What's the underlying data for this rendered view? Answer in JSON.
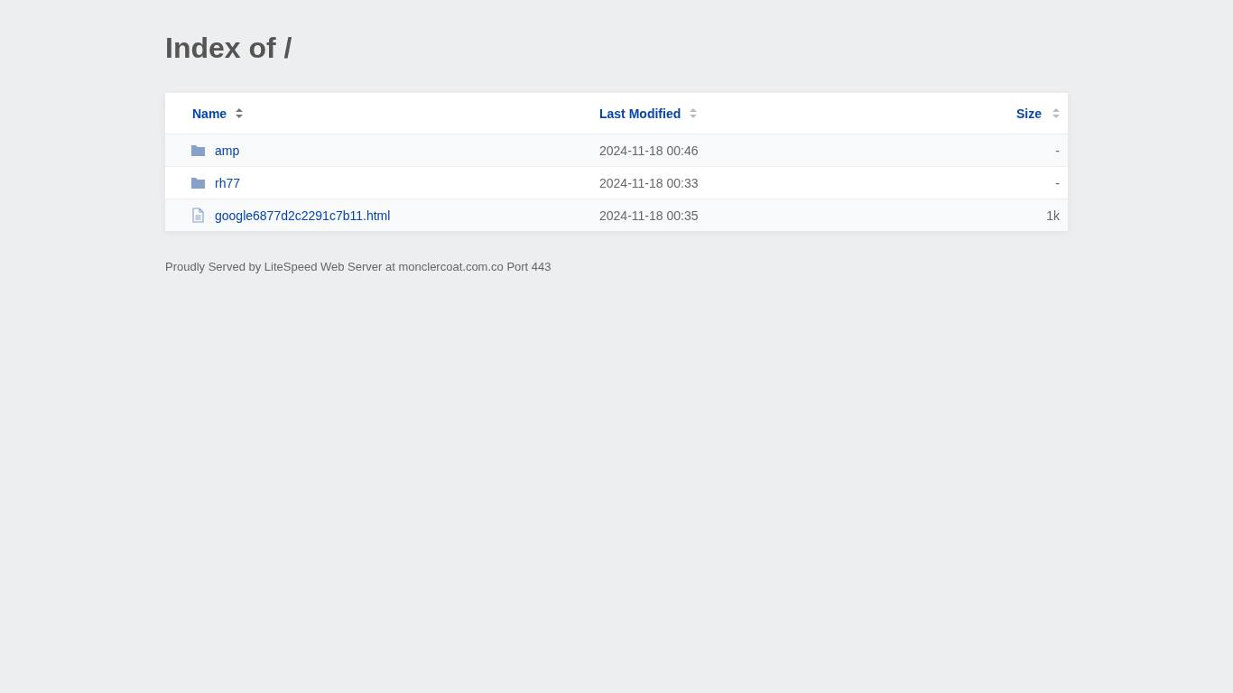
{
  "title": "Index of /",
  "columns": [
    {
      "label": "Name",
      "sorted": true
    },
    {
      "label": "Last Modified",
      "sorted": false
    },
    {
      "label": "Size",
      "sorted": false
    }
  ],
  "rows": [
    {
      "kind": "folder",
      "name": "amp",
      "modified": "2024-11-18 00:46",
      "size": "-"
    },
    {
      "kind": "folder",
      "name": "rh77",
      "modified": "2024-11-18 00:33",
      "size": "-"
    },
    {
      "kind": "file",
      "name": "google6877d2c2291c7b11.html",
      "modified": "2024-11-18 00:35",
      "size": "1k"
    }
  ],
  "footer": "Proudly Served by LiteSpeed Web Server at monclercoat.com.co Port 443"
}
